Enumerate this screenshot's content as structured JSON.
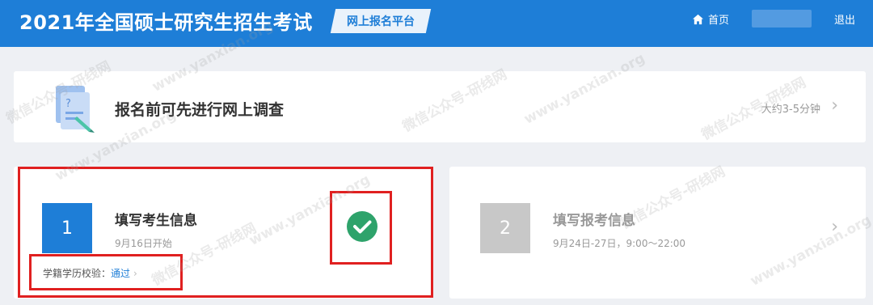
{
  "header": {
    "title": "2021年全国硕士研究生招生考试",
    "platform": "网上报名平台",
    "home": "首页",
    "logout": "退出"
  },
  "survey": {
    "title": "报名前可先进行网上调查",
    "time": "大约3-5分钟",
    "chevron": "›"
  },
  "steps": [
    {
      "number": "1",
      "title": "填写考生信息",
      "date": "9月16日开始",
      "verify_label": "学籍学历校验：",
      "verify_value": "通过",
      "verify_chevron": "›",
      "status": "completed"
    },
    {
      "number": "2",
      "title": "填写报考信息",
      "date": "9月24日-27日，9:00～22:00",
      "chevron": "›"
    }
  ],
  "watermarks": [
    "微信公众号-研线网",
    "www.yanxian.org"
  ],
  "colors": {
    "brand_blue": "#1e7ed7",
    "check_green": "#2ea36b",
    "annotation_red": "#e02020",
    "disabled_gray": "#c8c8c8"
  }
}
